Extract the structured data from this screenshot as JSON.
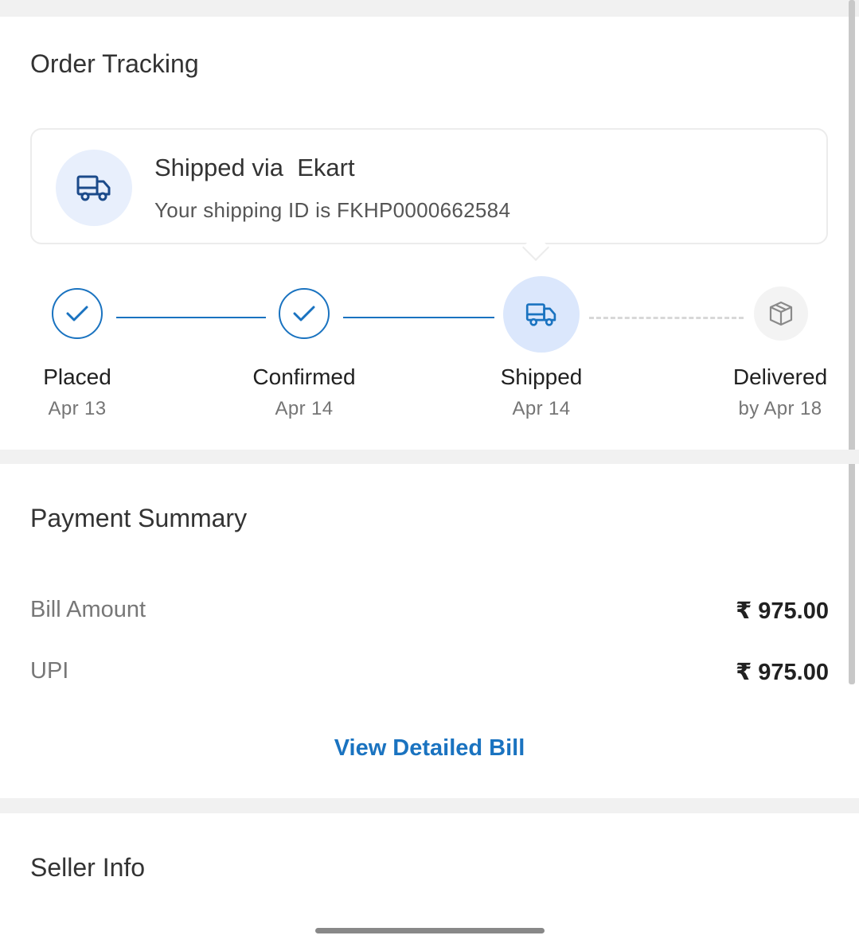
{
  "order_tracking": {
    "title": "Order Tracking",
    "shipping_card": {
      "title": "Shipped via  Ekart",
      "subtitle": "Your shipping ID is FKHP0000662584",
      "icon": "truck-icon"
    },
    "steps": [
      {
        "label": "Placed",
        "date": "Apr 13",
        "status": "done"
      },
      {
        "label": "Confirmed",
        "date": "Apr 14",
        "status": "done"
      },
      {
        "label": "Shipped",
        "date": "Apr 14",
        "status": "current"
      },
      {
        "label": "Delivered",
        "date": "by Apr 18",
        "status": "pending"
      }
    ]
  },
  "payment_summary": {
    "title": "Payment Summary",
    "rows": [
      {
        "label": "Bill Amount",
        "value": "₹ 975.00"
      },
      {
        "label": "UPI",
        "value": "₹ 975.00"
      }
    ],
    "link_label": "View Detailed Bill"
  },
  "seller_info": {
    "title": "Seller Info"
  },
  "colors": {
    "accent": "#1a73c0",
    "active_step_bg": "#dbe7fc",
    "divider": "#f1f1f1"
  }
}
